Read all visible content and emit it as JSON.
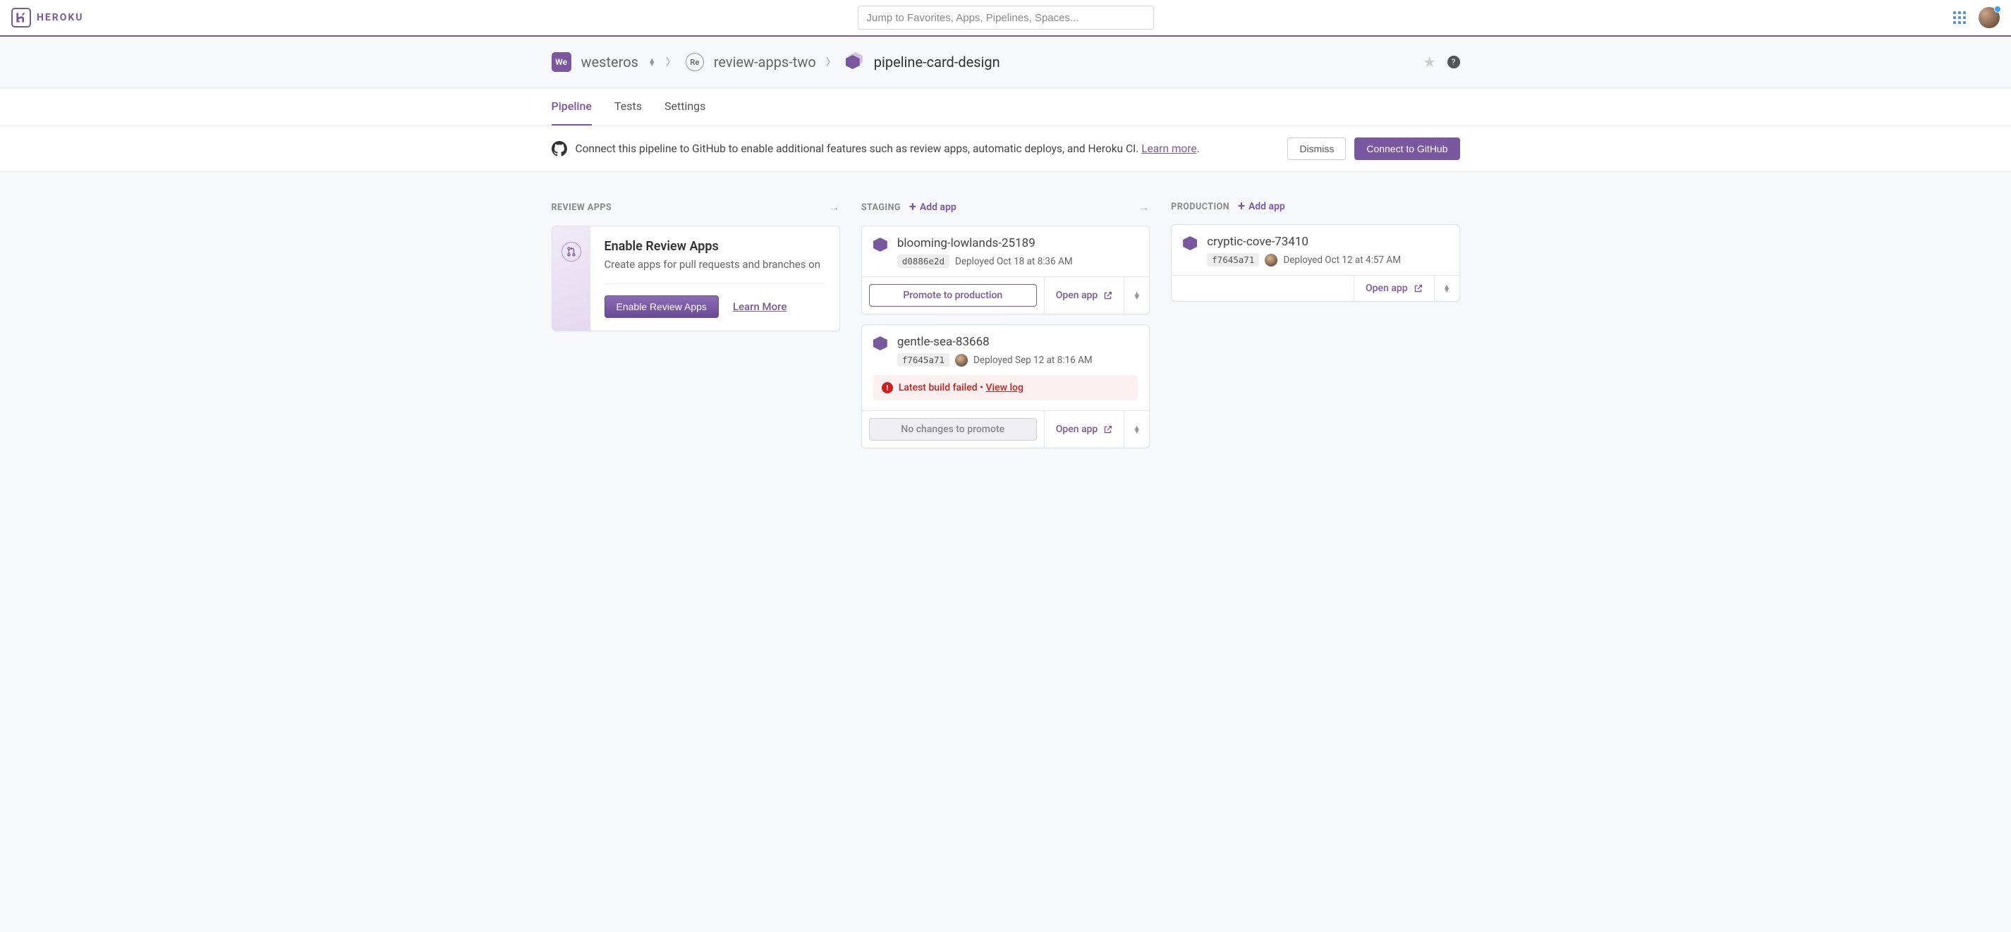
{
  "header": {
    "logo_text": "HEROKU",
    "search_placeholder": "Jump to Favorites, Apps, Pipelines, Spaces..."
  },
  "breadcrumb": {
    "team_icon_text": "We",
    "team": "westeros",
    "project_icon_text": "Re",
    "project": "review-apps-two",
    "pipeline": "pipeline-card-design"
  },
  "tabs": [
    {
      "label": "Pipeline",
      "active": true
    },
    {
      "label": "Tests",
      "active": false
    },
    {
      "label": "Settings",
      "active": false
    }
  ],
  "github_banner": {
    "text_prefix": "Connect this pipeline to GitHub to enable additional features such as review apps, automatic deploys, and Heroku CI. ",
    "learn_more": "Learn more",
    "period": ".",
    "dismiss": "Dismiss",
    "connect": "Connect to GitHub"
  },
  "columns": {
    "review": {
      "title": "REVIEW APPS",
      "card": {
        "title": "Enable Review Apps",
        "subtitle": "Create apps for pull requests and branches on",
        "enable_btn": "Enable Review Apps",
        "learn_more": "Learn More"
      }
    },
    "staging": {
      "title": "STAGING",
      "add_label": "Add app",
      "apps": [
        {
          "name": "blooming-lowlands-25189",
          "commit": "d0886e2d",
          "show_avatar": false,
          "deployed": "Deployed Oct 18 at 8:36 AM",
          "primary_action": "Promote to production",
          "primary_enabled": true,
          "open": "Open app",
          "alert": null
        },
        {
          "name": "gentle-sea-83668",
          "commit": "f7645a71",
          "show_avatar": true,
          "deployed": "Deployed Sep 12 at 8:16 AM",
          "primary_action": "No changes to promote",
          "primary_enabled": false,
          "open": "Open app",
          "alert": {
            "text": "Latest build failed",
            "link": "View log"
          }
        }
      ]
    },
    "production": {
      "title": "PRODUCTION",
      "add_label": "Add app",
      "apps": [
        {
          "name": "cryptic-cove-73410",
          "commit": "f7645a71",
          "show_avatar": true,
          "deployed": "Deployed Oct 12 at 4:57 AM",
          "open": "Open app"
        }
      ]
    }
  }
}
